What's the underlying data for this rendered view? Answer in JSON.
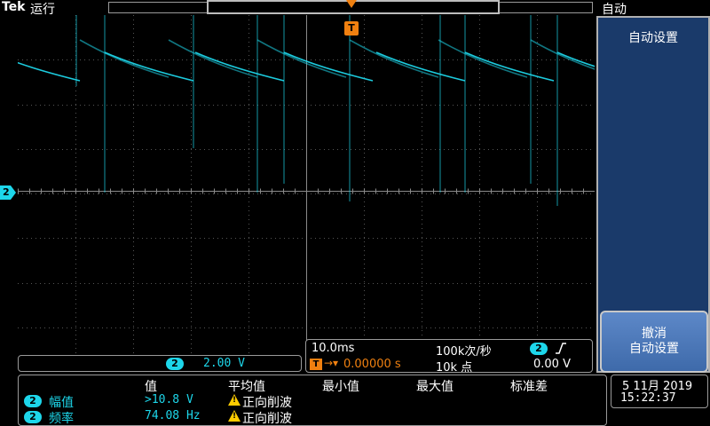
{
  "topbar": {
    "brand": "Tek",
    "run_state": "运行",
    "trigger_state": "自动"
  },
  "colors": {
    "channel2": "#1dd6ea",
    "trigger": "#f08010",
    "menu_bg": "#1a3a6a",
    "warning": "#ffcc00"
  },
  "side_menu": {
    "title": "自动设置",
    "undo_button_line1": "撤消",
    "undo_button_line2": "自动设置"
  },
  "channel": {
    "number": "2",
    "scale": "2.00 V"
  },
  "timebase": {
    "scale": "10.0ms",
    "sample_rate": "100k次/秒",
    "trigger_channel": "2",
    "trigger_delay": "0.00000 s",
    "record_length": "10k 点",
    "trigger_level": "0.00 V",
    "trigger_icon_letter": "T"
  },
  "measurements": {
    "headers": [
      "值",
      "平均值",
      "最小值",
      "最大值",
      "标准差"
    ],
    "rows": [
      {
        "channel": "2",
        "label": "幅值",
        "value": ">10.8 V",
        "average": "正向削波"
      },
      {
        "channel": "2",
        "label": "频率",
        "value": "74.08 Hz",
        "average": "正向削波"
      }
    ]
  },
  "clock": {
    "date": "5 11月 2019",
    "time": "15:22:37"
  }
}
